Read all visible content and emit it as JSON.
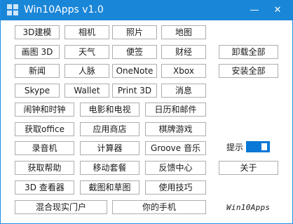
{
  "window": {
    "title": "Win10Apps v1.0",
    "minimize_glyph": "—",
    "close_glyph": "✕",
    "accent_color": "#1a86d8"
  },
  "buttons": {
    "modeling3d": "3D建模",
    "camera": "相机",
    "photos": "照片",
    "maps": "地图",
    "paint3d": "画图 3D",
    "weather": "天气",
    "sticky_notes": "便签",
    "money": "财经",
    "uninstall_all": "卸载全部",
    "news": "新闻",
    "people": "人脉",
    "onenote": "OneNote",
    "xbox": "Xbox",
    "install_all": "安装全部",
    "skype": "Skype",
    "wallet": "Wallet",
    "print3d": "Print 3D",
    "messaging": "消息",
    "alarms_clock": "闹钟和时钟",
    "movies_tv": "电影和电视",
    "calendar_mail": "日历和邮件",
    "get_office": "获取office",
    "store": "应用商店",
    "solitaire": "棋牌游戏",
    "voice_recorder": "录音机",
    "calculator": "计算器",
    "groove_music": "Groove 音乐",
    "get_help": "获取帮助",
    "mobile_plans": "移动套餐",
    "feedback_hub": "反馈中心",
    "about": "关于",
    "viewer3d": "3D 查看器",
    "snip_sketch": "截图和草图",
    "tips": "使用技巧",
    "mixed_reality_portal": "混合现实门户",
    "your_phone": "你的手机"
  },
  "toggle": {
    "label": "提示",
    "state": "on",
    "color": "#0a78d6"
  },
  "footer": {
    "brand": "Win10Apps"
  }
}
